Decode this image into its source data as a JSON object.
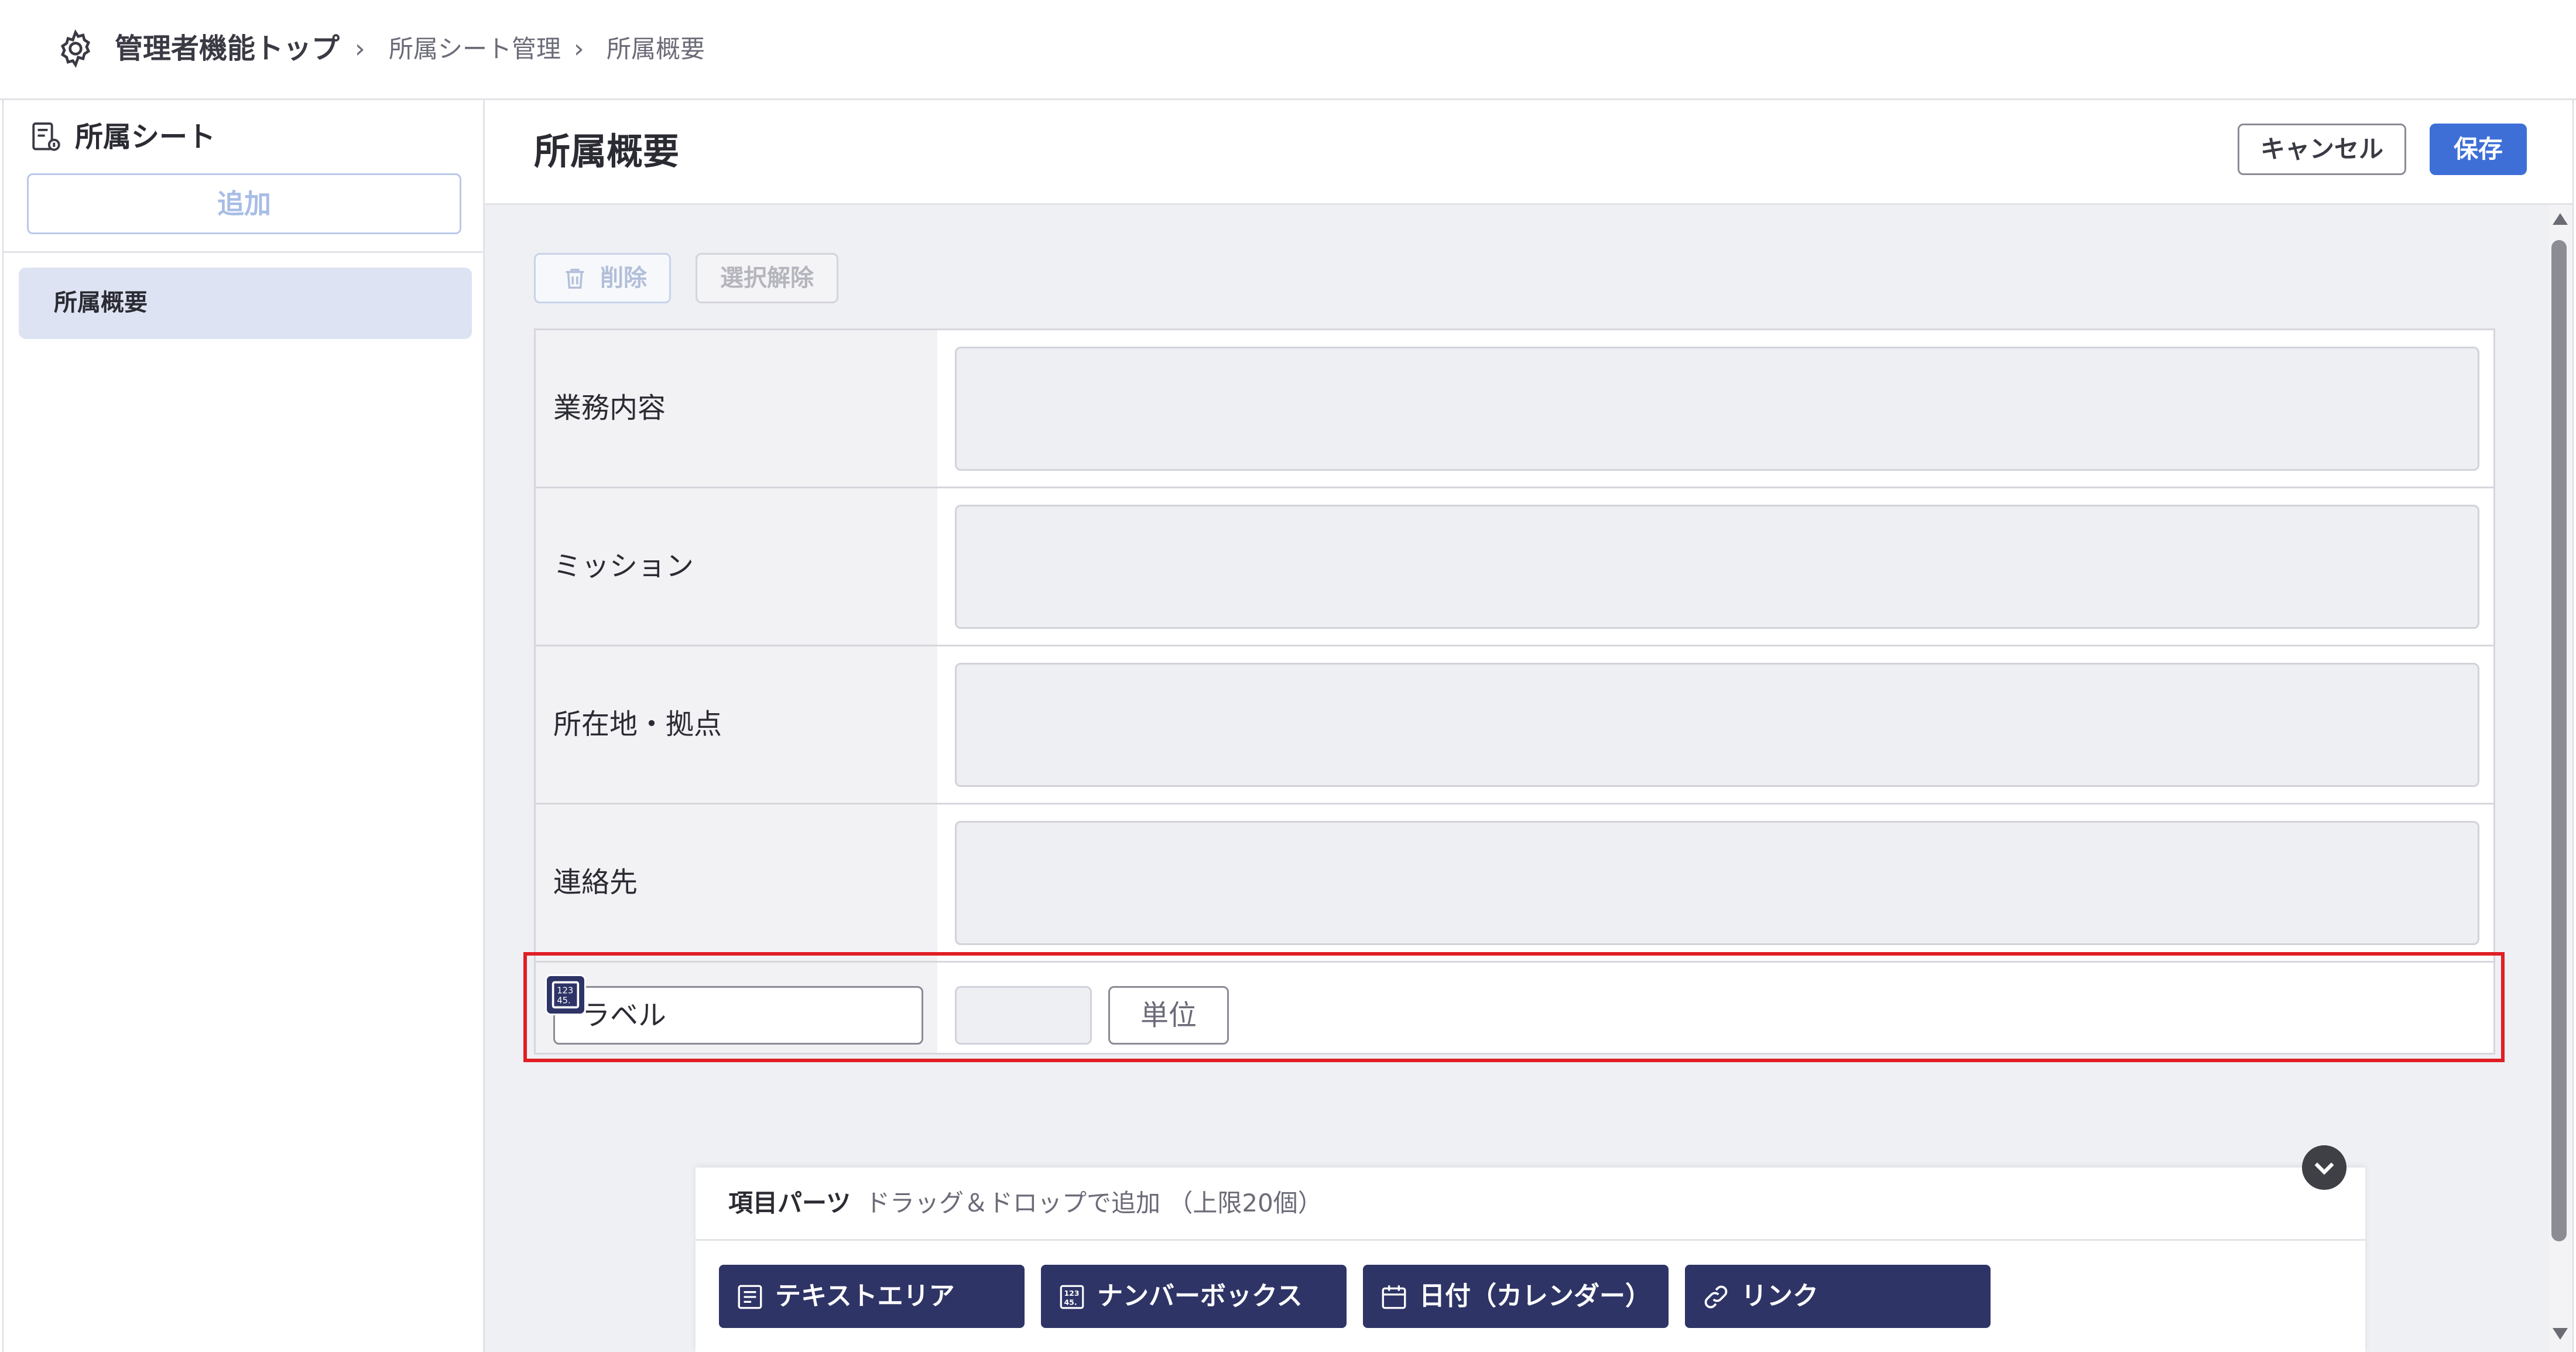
{
  "breadcrumb": {
    "root": "管理者機能トップ",
    "items": [
      "所属シート管理",
      "所属概要"
    ]
  },
  "sidebar": {
    "title": "所属シート",
    "add_label": "追加",
    "items": [
      {
        "label": "所属概要"
      }
    ]
  },
  "main": {
    "title": "所属概要",
    "cancel_label": "キャンセル",
    "save_label": "保存"
  },
  "toolbar": {
    "delete_label": "削除",
    "clear_label": "選択解除"
  },
  "form": {
    "rows": [
      {
        "label": "業務内容",
        "value": ""
      },
      {
        "label": "ミッション",
        "value": ""
      },
      {
        "label": "所在地・拠点",
        "value": ""
      },
      {
        "label": "連絡先",
        "value": ""
      }
    ],
    "new_item": {
      "label_placeholder": "ラベル",
      "value": "",
      "unit_label": "単位"
    }
  },
  "palette": {
    "title": "項目パーツ",
    "hint": "ドラッグ＆ドロップで追加 （上限20個）",
    "parts": [
      {
        "label": "テキストエリア",
        "icon": "text-area-icon"
      },
      {
        "label": "ナンバーボックス",
        "icon": "number-box-icon"
      },
      {
        "label": "日付（カレンダー）",
        "icon": "calendar-icon"
      },
      {
        "label": "リンク",
        "icon": "link-icon"
      }
    ]
  },
  "colors": {
    "accent": "#3d6fd6",
    "part_button": "#2e3466",
    "highlight": "#e01e24",
    "sidebar_selected": "#dde3f3"
  }
}
